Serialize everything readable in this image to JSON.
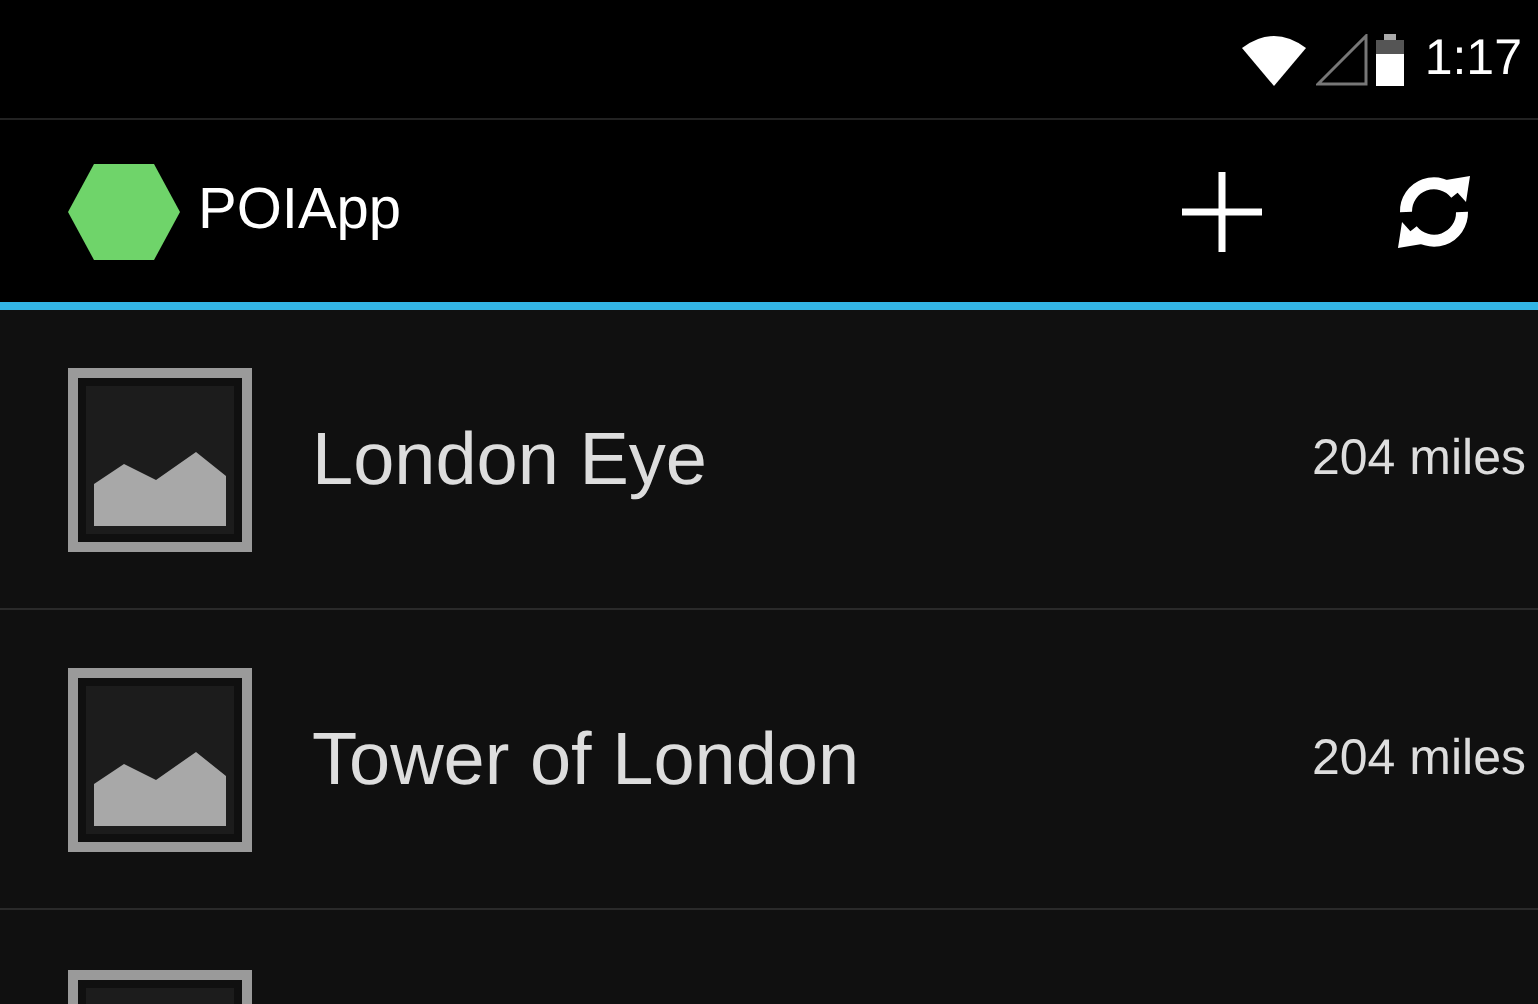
{
  "status_bar": {
    "time": "1:17"
  },
  "action_bar": {
    "title": "POIApp"
  },
  "list": [
    {
      "name": "London Eye",
      "distance": "204 miles"
    },
    {
      "name": "Tower of London",
      "distance": "204 miles"
    },
    {
      "partial": true
    }
  ]
}
